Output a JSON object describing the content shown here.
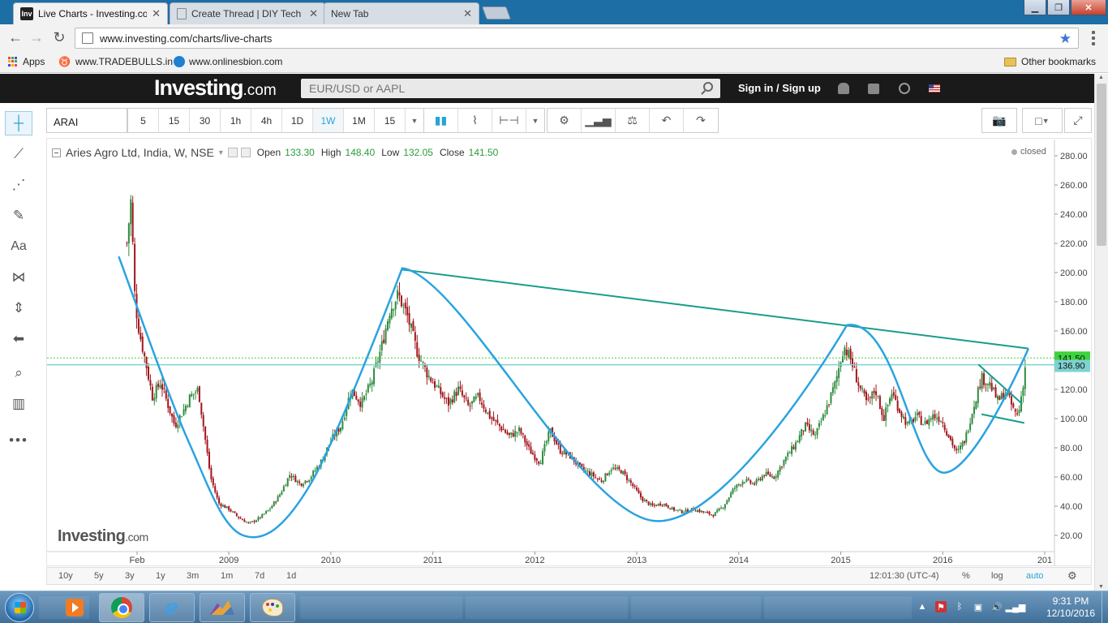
{
  "browser": {
    "tabs": [
      {
        "label": "Live Charts - Investing.co",
        "favicon": "Inv",
        "active": true
      },
      {
        "label": "Create Thread | DIY Tech",
        "active": false
      },
      {
        "label": "New Tab",
        "active": false
      }
    ],
    "url": "www.investing.com/charts/live-charts",
    "bookmarks": [
      {
        "label": "Apps"
      },
      {
        "label": "www.TRADEBULLS.in"
      },
      {
        "label": "www.onlinesbion.com"
      }
    ],
    "other_bookmarks": "Other bookmarks"
  },
  "site": {
    "logo": "Investing",
    "logo_suffix": ".com",
    "search_placeholder": "EUR/USD or AAPL",
    "sign_in": "Sign in",
    "sign_separator": "/",
    "sign_up": "Sign up"
  },
  "toolbar": {
    "symbol": "ARAI",
    "intervals": [
      "5",
      "15",
      "30",
      "1h",
      "4h",
      "1D",
      "1W",
      "1M",
      "15"
    ],
    "active_interval": "1W"
  },
  "legend": {
    "title": "Aries Agro Ltd, India, W, NSE",
    "open_label": "Open",
    "open": "133.30",
    "high_label": "High",
    "high": "148.40",
    "low_label": "Low",
    "low": "132.05",
    "close_label": "Close",
    "close": "141.50",
    "status": "closed",
    "watermark": "Investing",
    "watermark_suffix": ".com"
  },
  "ranges": [
    "10y",
    "5y",
    "3y",
    "1y",
    "3m",
    "1m",
    "7d",
    "1d"
  ],
  "range_bar": {
    "time": "12:01:30 (UTC-4)",
    "percent": "%",
    "log": "log",
    "auto": "auto"
  },
  "colors": {
    "up": "#2e8b3e",
    "down": "#a3151c",
    "trendline": "#1a9c8a",
    "pattern": "#2ba3e0",
    "price_tag": "#3cd33c",
    "level_tag": "#7fd2d2"
  },
  "chart_data": {
    "type": "candlestick",
    "title": "Aries Agro Ltd, India, W, NSE",
    "y_ticks": [
      "280.00",
      "260.00",
      "240.00",
      "220.00",
      "200.00",
      "180.00",
      "160.00",
      "140.00",
      "120.00",
      "100.00",
      "80.00",
      "60.00",
      "40.00",
      "20.00"
    ],
    "ylim": [
      13,
      292
    ],
    "x_ticks": [
      {
        "label": "Feb",
        "year": 2008.1
      },
      {
        "label": "2009",
        "year": 2009.0
      },
      {
        "label": "2010",
        "year": 2010.0
      },
      {
        "label": "2011",
        "year": 2011.0
      },
      {
        "label": "2012",
        "year": 2012.0
      },
      {
        "label": "2013",
        "year": 2013.0
      },
      {
        "label": "2014",
        "year": 2014.0
      },
      {
        "label": "2015",
        "year": 2015.0
      },
      {
        "label": "2016",
        "year": 2016.0
      },
      {
        "label": "201",
        "year": 2017.0
      }
    ],
    "last_price": "141.50",
    "last_price_value": 141.5,
    "level_label": "136.90",
    "level_value": 136.9,
    "price_path": [
      [
        2008.0,
        220
      ],
      [
        2008.04,
        250
      ],
      [
        2008.08,
        180
      ],
      [
        2008.12,
        160
      ],
      [
        2008.18,
        140
      ],
      [
        2008.25,
        115
      ],
      [
        2008.33,
        125
      ],
      [
        2008.4,
        110
      ],
      [
        2008.47,
        95
      ],
      [
        2008.55,
        105
      ],
      [
        2008.62,
        115
      ],
      [
        2008.7,
        120
      ],
      [
        2008.76,
        90
      ],
      [
        2008.82,
        60
      ],
      [
        2008.9,
        42
      ],
      [
        2009.0,
        38
      ],
      [
        2009.1,
        32
      ],
      [
        2009.2,
        28
      ],
      [
        2009.3,
        32
      ],
      [
        2009.4,
        38
      ],
      [
        2009.5,
        48
      ],
      [
        2009.6,
        62
      ],
      [
        2009.7,
        55
      ],
      [
        2009.8,
        60
      ],
      [
        2009.9,
        70
      ],
      [
        2010.0,
        85
      ],
      [
        2010.1,
        95
      ],
      [
        2010.2,
        120
      ],
      [
        2010.3,
        110
      ],
      [
        2010.4,
        125
      ],
      [
        2010.5,
        150
      ],
      [
        2010.58,
        175
      ],
      [
        2010.66,
        185
      ],
      [
        2010.75,
        170
      ],
      [
        2010.85,
        145
      ],
      [
        2010.95,
        130
      ],
      [
        2011.05,
        120
      ],
      [
        2011.15,
        110
      ],
      [
        2011.25,
        120
      ],
      [
        2011.35,
        108
      ],
      [
        2011.45,
        115
      ],
      [
        2011.55,
        102
      ],
      [
        2011.65,
        95
      ],
      [
        2011.75,
        88
      ],
      [
        2011.85,
        92
      ],
      [
        2011.95,
        78
      ],
      [
        2012.05,
        70
      ],
      [
        2012.15,
        92
      ],
      [
        2012.25,
        78
      ],
      [
        2012.35,
        74
      ],
      [
        2012.45,
        66
      ],
      [
        2012.55,
        62
      ],
      [
        2012.65,
        57
      ],
      [
        2012.75,
        66
      ],
      [
        2012.85,
        64
      ],
      [
        2012.95,
        55
      ],
      [
        2013.05,
        45
      ],
      [
        2013.15,
        40
      ],
      [
        2013.25,
        42
      ],
      [
        2013.35,
        38
      ],
      [
        2013.45,
        36
      ],
      [
        2013.55,
        38
      ],
      [
        2013.65,
        36
      ],
      [
        2013.75,
        34
      ],
      [
        2013.85,
        40
      ],
      [
        2013.95,
        52
      ],
      [
        2014.05,
        58
      ],
      [
        2014.15,
        55
      ],
      [
        2014.25,
        62
      ],
      [
        2014.35,
        60
      ],
      [
        2014.45,
        72
      ],
      [
        2014.55,
        82
      ],
      [
        2014.65,
        95
      ],
      [
        2014.75,
        88
      ],
      [
        2014.85,
        105
      ],
      [
        2014.95,
        125
      ],
      [
        2015.03,
        150
      ],
      [
        2015.1,
        140
      ],
      [
        2015.18,
        122
      ],
      [
        2015.26,
        110
      ],
      [
        2015.34,
        120
      ],
      [
        2015.42,
        100
      ],
      [
        2015.5,
        118
      ],
      [
        2015.58,
        105
      ],
      [
        2015.66,
        95
      ],
      [
        2015.74,
        102
      ],
      [
        2015.82,
        96
      ],
      [
        2015.9,
        102
      ],
      [
        2015.98,
        100
      ],
      [
        2016.06,
        88
      ],
      [
        2016.14,
        76
      ],
      [
        2016.22,
        86
      ],
      [
        2016.3,
        108
      ],
      [
        2016.38,
        128
      ],
      [
        2016.46,
        124
      ],
      [
        2016.54,
        112
      ],
      [
        2016.62,
        118
      ],
      [
        2016.7,
        105
      ],
      [
        2016.74,
        102
      ],
      [
        2016.78,
        120
      ],
      [
        2016.82,
        141.5
      ]
    ],
    "overlays": {
      "resistance_line": [
        [
          2010.7,
          202
        ],
        [
          2016.84,
          148
        ]
      ],
      "cup_pattern": [
        [
          2007.92,
          211
        ],
        [
          2008.6,
          85
        ],
        [
          2009.14,
          20
        ],
        [
          2009.8,
          55
        ],
        [
          2010.7,
          203
        ],
        [
          2013.16,
          30
        ],
        [
          2015.06,
          164
        ],
        [
          2016.0,
          63
        ],
        [
          2016.84,
          148
        ]
      ],
      "flag_upper": [
        [
          2016.35,
          137
        ],
        [
          2016.78,
          110
        ]
      ],
      "flag_lower": [
        [
          2016.38,
          103
        ],
        [
          2016.8,
          97
        ]
      ]
    }
  }
}
